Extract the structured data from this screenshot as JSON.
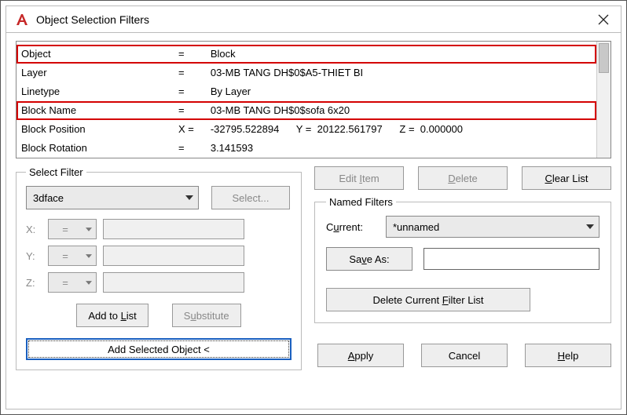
{
  "title": "Object Selection Filters",
  "list": {
    "rows": [
      {
        "name": "Object",
        "op": "=",
        "val": "Block",
        "highlight": true
      },
      {
        "name": "Layer",
        "op": "=",
        "val": "03-MB TANG DH$0$A5-THIET BI"
      },
      {
        "name": "Linetype",
        "op": "=",
        "val": "By Layer"
      },
      {
        "name": "Block Name",
        "op": "=",
        "val": "03-MB TANG DH$0$sofa 6x20",
        "highlight": true
      },
      {
        "name": "Block Position",
        "op": "X =",
        "val": "-32795.522894      Y =  20122.561797      Z =  0.000000"
      },
      {
        "name": "Block Rotation",
        "op": "=",
        "val": "3.141593"
      }
    ]
  },
  "selectFilter": {
    "legend": "Select Filter",
    "combo": "3dface",
    "selectBtn": "Select...",
    "x": "X:",
    "y": "Y:",
    "z": "Z:",
    "op": "=",
    "addToList": "Add to List",
    "substitute": "Substitute",
    "addSelected": "Add Selected Object <"
  },
  "rightButtons": {
    "editItem": "Edit Item",
    "delete": "Delete",
    "clearList": "Clear List"
  },
  "named": {
    "legend": "Named Filters",
    "current": "Current:",
    "currentVal": "*unnamed",
    "saveAs": "Save As:",
    "deleteCurrent": "Delete Current Filter List"
  },
  "bottom": {
    "apply": "Apply",
    "cancel": "Cancel",
    "help": "Help"
  }
}
